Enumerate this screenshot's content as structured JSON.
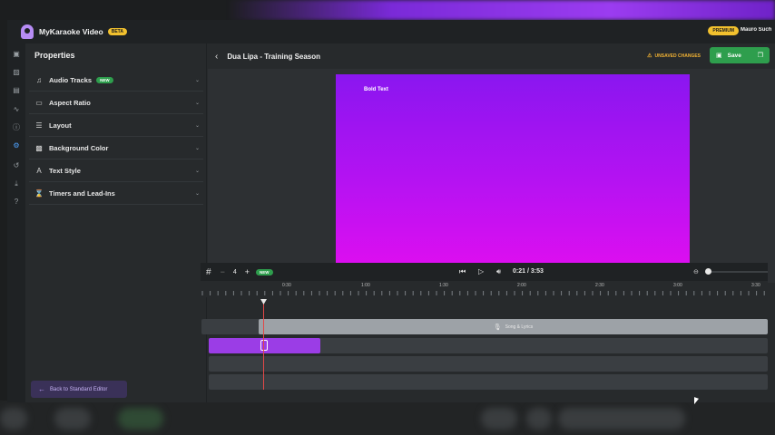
{
  "app": {
    "title": "MyKaraoke Video",
    "badge": "BETA",
    "plan": "PREMIUM",
    "user": "Mauro Such"
  },
  "sidebar_icons": [
    "text-icon",
    "image-icon",
    "film-icon",
    "waveform-icon",
    "info-icon",
    "settings-icon",
    "history-icon",
    "download-icon",
    "help-icon"
  ],
  "properties": {
    "title": "Properties",
    "items": [
      {
        "label": "Audio Tracks",
        "badge": "NEW",
        "icon": "music-note-icon"
      },
      {
        "label": "Aspect Ratio",
        "badge": "",
        "icon": "aspect-ratio-icon"
      },
      {
        "label": "Layout",
        "badge": "",
        "icon": "layout-icon"
      },
      {
        "label": "Background Color",
        "badge": "",
        "icon": "background-pattern-icon"
      },
      {
        "label": "Text Style",
        "badge": "",
        "icon": "text-style-icon"
      },
      {
        "label": "Timers and Lead-Ins",
        "badge": "",
        "icon": "timer-icon"
      }
    ],
    "back_label": "Back to Standard Editor"
  },
  "editor": {
    "song_title": "Dua Lipa - Training Season",
    "unsaved": "UNSAVED CHANGES",
    "save_label": "Save",
    "preview_text": "Bold Text",
    "accent": "#2e9e4d",
    "preview_gradient": [
      "#8a16f0",
      "#e00ef0"
    ]
  },
  "timeline": {
    "zoom_value": "4",
    "new_badge": "NEW",
    "time": "0:21 / 3:53",
    "ruler": [
      "0:30",
      "1:00",
      "1:30",
      "2:00",
      "2:30",
      "3:00",
      "3:30"
    ],
    "lyrics_clip": "Song & Lyrics"
  }
}
